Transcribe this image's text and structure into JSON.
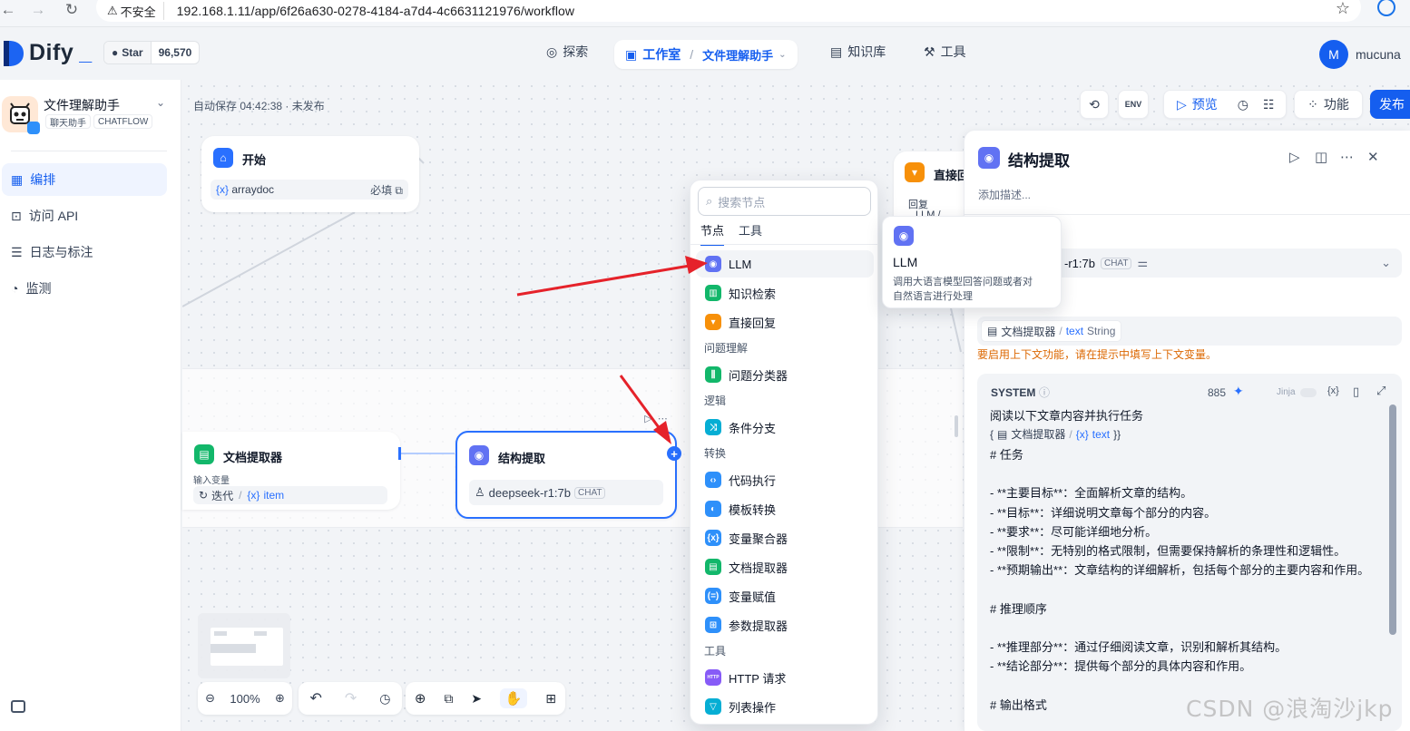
{
  "browser": {
    "insecure_label": "不安全",
    "url": "192.168.1.11/app/6f26a630-0278-4184-a7d4-4c6631121976/workflow"
  },
  "header": {
    "logo": "Dify",
    "github_star_label": "Star",
    "github_star_count": "96,570",
    "nav_explore": "探索",
    "nav_studio": "工作室",
    "nav_app": "文件理解助手",
    "nav_knowledge": "知识库",
    "nav_tools": "工具",
    "avatar_letter": "M",
    "user_name": "mucuna"
  },
  "sidebar": {
    "app_name": "文件理解助手",
    "app_type_label": "聊天助手",
    "app_mode": "CHATFLOW",
    "items": [
      {
        "label": "编排",
        "icon": "layout-icon",
        "active": true
      },
      {
        "label": "访问 API",
        "icon": "terminal-icon",
        "active": false
      },
      {
        "label": "日志与标注",
        "icon": "file-list-icon",
        "active": false
      },
      {
        "label": "监测",
        "icon": "gauge-icon",
        "active": false
      }
    ]
  },
  "canvas": {
    "autosave": "自动保存 04:42:38 · 未发布",
    "preview_label": "预览",
    "features_label": "功能",
    "publish_label": "发布",
    "zoom": "100%"
  },
  "nodes": {
    "start": {
      "title": "开始",
      "var": "arraydoc",
      "required": "必填"
    },
    "direct_reply": {
      "title": "直接回",
      "sub": "回复",
      "llm_fragment": "LLM /"
    },
    "doc_extractor": {
      "title": "文档提取器",
      "input_label": "输入变量",
      "iter_label": "迭代",
      "item_label": "item"
    },
    "struct_extract": {
      "title": "结构提取",
      "model": "deepseek-r1:7b",
      "model_tag": "CHAT"
    }
  },
  "node_picker": {
    "search_placeholder": "搜索节点",
    "tab_nodes": "节点",
    "tab_tools": "工具",
    "items_top": [
      {
        "label": "LLM",
        "icon": "llm-icon",
        "color": "#6172f3"
      },
      {
        "label": "知识检索",
        "icon": "knowledge-icon",
        "color": "#12b76a"
      },
      {
        "label": "直接回复",
        "icon": "reply-icon",
        "color": "#f79009"
      }
    ],
    "group_understanding": "问题理解",
    "items_understanding": [
      {
        "label": "问题分类器",
        "icon": "classifier-icon",
        "color": "#12b76a"
      }
    ],
    "group_logic": "逻辑",
    "items_logic": [
      {
        "label": "条件分支",
        "icon": "branch-icon",
        "color": "#06aed4"
      }
    ],
    "group_transform": "转换",
    "items_transform": [
      {
        "label": "代码执行",
        "icon": "code-icon",
        "color": "#2e90fa"
      },
      {
        "label": "模板转换",
        "icon": "template-icon",
        "color": "#2e90fa"
      },
      {
        "label": "变量聚合器",
        "icon": "variable-icon",
        "color": "#2e90fa"
      },
      {
        "label": "文档提取器",
        "icon": "doc-icon",
        "color": "#12b76a"
      },
      {
        "label": "变量赋值",
        "icon": "assign-icon",
        "color": "#2e90fa"
      },
      {
        "label": "参数提取器",
        "icon": "param-icon",
        "color": "#2e90fa"
      }
    ],
    "group_tools": "工具",
    "items_tools": [
      {
        "label": "HTTP 请求",
        "icon": "http-icon",
        "color": "#875bf7",
        "badge": "HTTP"
      },
      {
        "label": "列表操作",
        "icon": "list-icon",
        "color": "#06aed4"
      }
    ]
  },
  "llm_tooltip": {
    "title": "LLM",
    "desc_line1": "调用大语言模型回答问题或者对",
    "desc_line2": "自然语言进行处理"
  },
  "panel": {
    "title": "结构提取",
    "desc_placeholder": "添加描述...",
    "model_fragment": "-r1:7b",
    "model_tag": "CHAT",
    "context_var_node": "文档提取器",
    "context_var_name": "text",
    "context_var_type": "String",
    "warning": "要启用上下文功能，请在提示中填写上下文变量。",
    "system_label": "SYSTEM",
    "token_count": "885",
    "jinja_label": "Jinja",
    "prompt_line1": "阅读以下文章内容并执行任务",
    "prompt_var_node": "文档提取器",
    "prompt_var_name": "text",
    "prompt_body": "# 任务\n\n- **主要目标**：全面解析文章的结构。\n- **目标**：详细说明文章每个部分的内容。\n- **要求**：尽可能详细地分析。\n- **限制**：无特别的格式限制，但需要保持解析的条理性和逻辑性。\n- **预期输出**：文章结构的详细解析，包括每个部分的主要内容和作用。\n\n# 推理顺序\n\n- **推理部分**：通过仔细阅读文章，识别和解析其结构。\n- **结论部分**：提供每个部分的具体内容和作用。\n\n# 输出格式"
  },
  "watermark": "CSDN @浪淘沙jkp",
  "colors": {
    "accent": "#155eef",
    "warning": "#dc6803",
    "arrow": "#e5222a"
  }
}
